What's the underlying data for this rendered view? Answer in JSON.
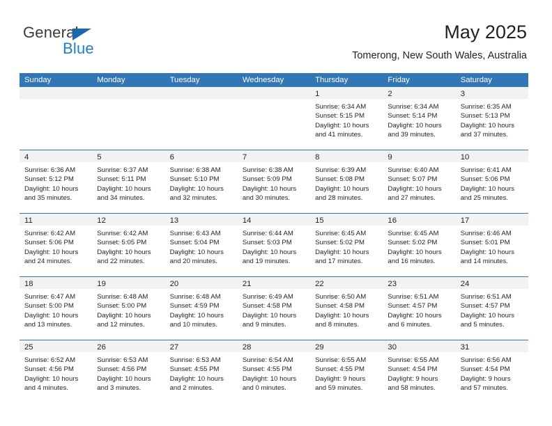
{
  "brand": {
    "name_top": "General",
    "name_bottom": "Blue",
    "triangle_color": "#1769b0",
    "blue_text_color": "#1b7fd1"
  },
  "header": {
    "title": "May 2025",
    "subtitle": "Tomerong, New South Wales, Australia"
  },
  "theme": {
    "header_blue": "#3177b8",
    "daynum_band_gray": "#f2f2f2",
    "text_color": "#231f20"
  },
  "weekday_headers": [
    "Sunday",
    "Monday",
    "Tuesday",
    "Wednesday",
    "Thursday",
    "Friday",
    "Saturday"
  ],
  "weeks": [
    [
      {
        "day": "",
        "lines": []
      },
      {
        "day": "",
        "lines": []
      },
      {
        "day": "",
        "lines": []
      },
      {
        "day": "",
        "lines": []
      },
      {
        "day": "1",
        "lines": [
          "Sunrise: 6:34 AM",
          "Sunset: 5:15 PM",
          "Daylight: 10 hours",
          "and 41 minutes."
        ]
      },
      {
        "day": "2",
        "lines": [
          "Sunrise: 6:34 AM",
          "Sunset: 5:14 PM",
          "Daylight: 10 hours",
          "and 39 minutes."
        ]
      },
      {
        "day": "3",
        "lines": [
          "Sunrise: 6:35 AM",
          "Sunset: 5:13 PM",
          "Daylight: 10 hours",
          "and 37 minutes."
        ]
      }
    ],
    [
      {
        "day": "4",
        "lines": [
          "Sunrise: 6:36 AM",
          "Sunset: 5:12 PM",
          "Daylight: 10 hours",
          "and 35 minutes."
        ]
      },
      {
        "day": "5",
        "lines": [
          "Sunrise: 6:37 AM",
          "Sunset: 5:11 PM",
          "Daylight: 10 hours",
          "and 34 minutes."
        ]
      },
      {
        "day": "6",
        "lines": [
          "Sunrise: 6:38 AM",
          "Sunset: 5:10 PM",
          "Daylight: 10 hours",
          "and 32 minutes."
        ]
      },
      {
        "day": "7",
        "lines": [
          "Sunrise: 6:38 AM",
          "Sunset: 5:09 PM",
          "Daylight: 10 hours",
          "and 30 minutes."
        ]
      },
      {
        "day": "8",
        "lines": [
          "Sunrise: 6:39 AM",
          "Sunset: 5:08 PM",
          "Daylight: 10 hours",
          "and 28 minutes."
        ]
      },
      {
        "day": "9",
        "lines": [
          "Sunrise: 6:40 AM",
          "Sunset: 5:07 PM",
          "Daylight: 10 hours",
          "and 27 minutes."
        ]
      },
      {
        "day": "10",
        "lines": [
          "Sunrise: 6:41 AM",
          "Sunset: 5:06 PM",
          "Daylight: 10 hours",
          "and 25 minutes."
        ]
      }
    ],
    [
      {
        "day": "11",
        "lines": [
          "Sunrise: 6:42 AM",
          "Sunset: 5:06 PM",
          "Daylight: 10 hours",
          "and 24 minutes."
        ]
      },
      {
        "day": "12",
        "lines": [
          "Sunrise: 6:42 AM",
          "Sunset: 5:05 PM",
          "Daylight: 10 hours",
          "and 22 minutes."
        ]
      },
      {
        "day": "13",
        "lines": [
          "Sunrise: 6:43 AM",
          "Sunset: 5:04 PM",
          "Daylight: 10 hours",
          "and 20 minutes."
        ]
      },
      {
        "day": "14",
        "lines": [
          "Sunrise: 6:44 AM",
          "Sunset: 5:03 PM",
          "Daylight: 10 hours",
          "and 19 minutes."
        ]
      },
      {
        "day": "15",
        "lines": [
          "Sunrise: 6:45 AM",
          "Sunset: 5:02 PM",
          "Daylight: 10 hours",
          "and 17 minutes."
        ]
      },
      {
        "day": "16",
        "lines": [
          "Sunrise: 6:45 AM",
          "Sunset: 5:02 PM",
          "Daylight: 10 hours",
          "and 16 minutes."
        ]
      },
      {
        "day": "17",
        "lines": [
          "Sunrise: 6:46 AM",
          "Sunset: 5:01 PM",
          "Daylight: 10 hours",
          "and 14 minutes."
        ]
      }
    ],
    [
      {
        "day": "18",
        "lines": [
          "Sunrise: 6:47 AM",
          "Sunset: 5:00 PM",
          "Daylight: 10 hours",
          "and 13 minutes."
        ]
      },
      {
        "day": "19",
        "lines": [
          "Sunrise: 6:48 AM",
          "Sunset: 5:00 PM",
          "Daylight: 10 hours",
          "and 12 minutes."
        ]
      },
      {
        "day": "20",
        "lines": [
          "Sunrise: 6:48 AM",
          "Sunset: 4:59 PM",
          "Daylight: 10 hours",
          "and 10 minutes."
        ]
      },
      {
        "day": "21",
        "lines": [
          "Sunrise: 6:49 AM",
          "Sunset: 4:58 PM",
          "Daylight: 10 hours",
          "and 9 minutes."
        ]
      },
      {
        "day": "22",
        "lines": [
          "Sunrise: 6:50 AM",
          "Sunset: 4:58 PM",
          "Daylight: 10 hours",
          "and 8 minutes."
        ]
      },
      {
        "day": "23",
        "lines": [
          "Sunrise: 6:51 AM",
          "Sunset: 4:57 PM",
          "Daylight: 10 hours",
          "and 6 minutes."
        ]
      },
      {
        "day": "24",
        "lines": [
          "Sunrise: 6:51 AM",
          "Sunset: 4:57 PM",
          "Daylight: 10 hours",
          "and 5 minutes."
        ]
      }
    ],
    [
      {
        "day": "25",
        "lines": [
          "Sunrise: 6:52 AM",
          "Sunset: 4:56 PM",
          "Daylight: 10 hours",
          "and 4 minutes."
        ]
      },
      {
        "day": "26",
        "lines": [
          "Sunrise: 6:53 AM",
          "Sunset: 4:56 PM",
          "Daylight: 10 hours",
          "and 3 minutes."
        ]
      },
      {
        "day": "27",
        "lines": [
          "Sunrise: 6:53 AM",
          "Sunset: 4:55 PM",
          "Daylight: 10 hours",
          "and 2 minutes."
        ]
      },
      {
        "day": "28",
        "lines": [
          "Sunrise: 6:54 AM",
          "Sunset: 4:55 PM",
          "Daylight: 10 hours",
          "and 0 minutes."
        ]
      },
      {
        "day": "29",
        "lines": [
          "Sunrise: 6:55 AM",
          "Sunset: 4:55 PM",
          "Daylight: 9 hours",
          "and 59 minutes."
        ]
      },
      {
        "day": "30",
        "lines": [
          "Sunrise: 6:55 AM",
          "Sunset: 4:54 PM",
          "Daylight: 9 hours",
          "and 58 minutes."
        ]
      },
      {
        "day": "31",
        "lines": [
          "Sunrise: 6:56 AM",
          "Sunset: 4:54 PM",
          "Daylight: 9 hours",
          "and 57 minutes."
        ]
      }
    ]
  ]
}
